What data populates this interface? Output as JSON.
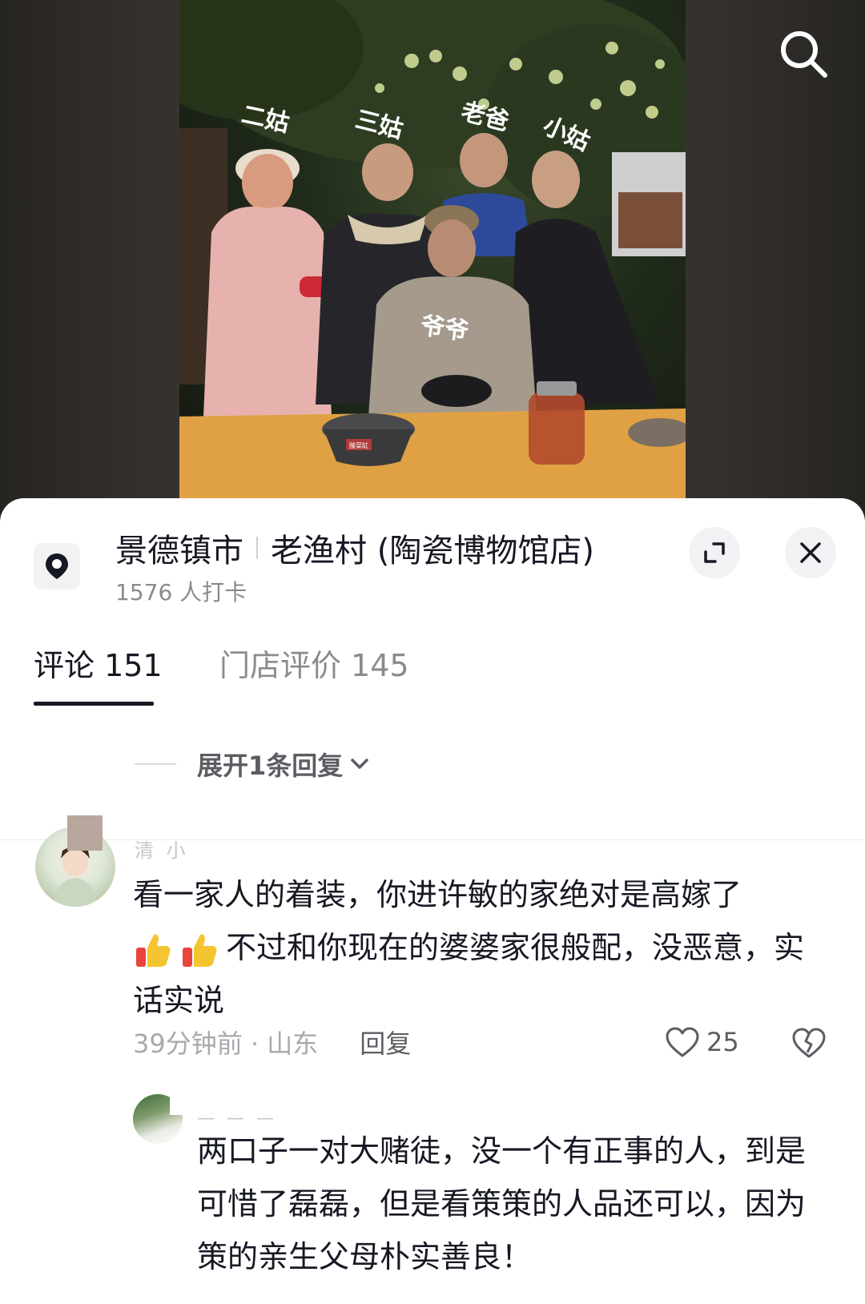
{
  "photo": {
    "labels": [
      "二姑",
      "三姑",
      "老爸",
      "小姑",
      "爷爷"
    ],
    "sign_text": "酸菜缸"
  },
  "location": {
    "city": "景德镇市",
    "name": "老渔村 (陶瓷博物馆店)",
    "checkins": "1576 人打卡"
  },
  "tabs": {
    "comments": "评论 151",
    "reviews": "门店评价 145"
  },
  "expand_replies": "展开1条回复",
  "comment1": {
    "username": "清 小",
    "text_a": "看一家人的着装，你进许敏的家绝对是高嫁了",
    "text_b": "不过和你现在的婆婆家很般配，没恶意，实话实说",
    "time_region": "39分钟前 · 山东",
    "reply_label": "回复",
    "likes": "25"
  },
  "reply1": {
    "username": "— — —",
    "text": "两口子一对大赌徒，没一个有正事的人，到是可惜了磊磊，但是看策策的人品还可以，因为策的亲生父母朴实善良！"
  },
  "colors": {
    "text_primary": "#161823",
    "text_secondary": "#8a8b91",
    "accent_like": "#5c5d63"
  }
}
